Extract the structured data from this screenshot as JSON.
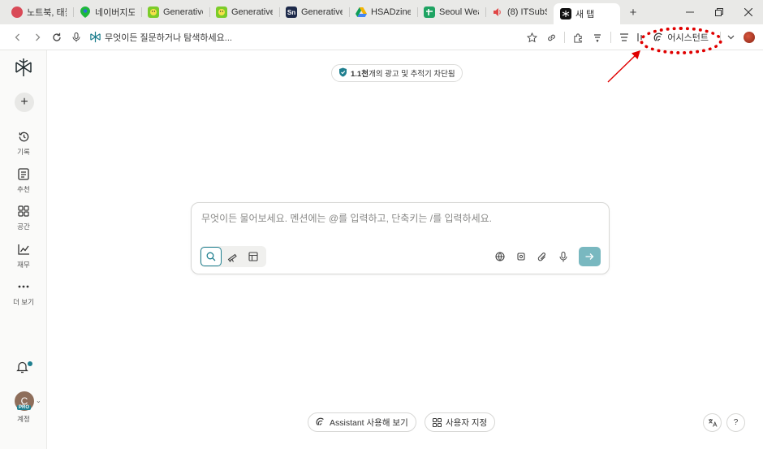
{
  "tabs": [
    {
      "label": "노트북, 태블",
      "icon": "sticker-icon",
      "color": "#d94a57"
    },
    {
      "label": "네이버지도",
      "icon": "map-pin-icon",
      "color": "#1db83c"
    },
    {
      "label": "Generative",
      "icon": "green-face-icon",
      "color": "#7ccc2a"
    },
    {
      "label": "Generative",
      "icon": "green-face-icon",
      "color": "#7ccc2a"
    },
    {
      "label": "Generative",
      "icon": "sn-logo-icon",
      "color": "#1d2a4a",
      "text": "Sn"
    },
    {
      "label": "HSADzine",
      "icon": "drive-icon",
      "color": "#f4b400"
    },
    {
      "label": "Seoul Wea",
      "icon": "sheets-icon",
      "color": "#1ea362"
    },
    {
      "label": "(8) ITSubS",
      "icon": "speaker-icon",
      "color": "#e04646"
    },
    {
      "label": "새 탭",
      "icon": "perplexity-icon",
      "color": "#111111",
      "active": true
    }
  ],
  "addressbar": {
    "placeholder": "무엇이든 질문하거나 탐색하세요...",
    "assistant_label": "어시스턴트"
  },
  "banner": {
    "count": "1.1천",
    "text": "개의 광고 및 추적기 차단됨"
  },
  "sidebar": {
    "items": [
      {
        "label": "기록",
        "icon": "history-icon"
      },
      {
        "label": "추천",
        "icon": "discover-icon"
      },
      {
        "label": "공간",
        "icon": "spaces-icon"
      },
      {
        "label": "재무",
        "icon": "finance-icon"
      },
      {
        "label": "더 보기",
        "icon": "more-icon"
      }
    ],
    "avatar_initial": "C",
    "pro_badge": "PRO",
    "account_label": "계정"
  },
  "search": {
    "placeholder": "무엇이든 물어보세요. 멘션에는 @를 입력하고, 단축키는 /를 입력하세요."
  },
  "bottom": {
    "assistant_chip": "Assistant 사용해 보기",
    "customize_chip": "사용자 지정",
    "help": "?"
  },
  "colors": {
    "accent": "#1f7f8f",
    "annotation": "#e00000"
  }
}
